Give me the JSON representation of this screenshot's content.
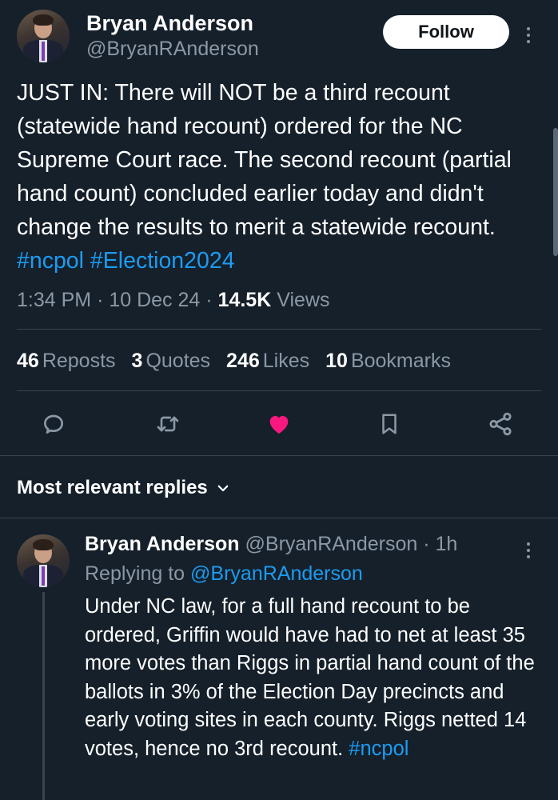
{
  "main_tweet": {
    "author_name": "Bryan Anderson",
    "author_handle": "@BryanRAnderson",
    "follow_label": "Follow",
    "text_parts": {
      "body": "JUST IN: There will NOT be a third recount (statewide hand recount) ordered for the NC Supreme Court race. The second recount (partial hand count) concluded earlier today and didn't change the results to merit a statewide recount. ",
      "hashtag1": "#ncpol",
      "hashtag2": "#Election2024"
    },
    "time": "1:34 PM",
    "date": "10 Dec 24",
    "views_count": "14.5K",
    "views_label": "Views"
  },
  "stats": {
    "reposts_count": "46",
    "reposts_label": "Reposts",
    "quotes_count": "3",
    "quotes_label": "Quotes",
    "likes_count": "246",
    "likes_label": "Likes",
    "bookmarks_count": "10",
    "bookmarks_label": "Bookmarks"
  },
  "actions": {
    "reply_icon": "reply-icon",
    "repost_icon": "repost-icon",
    "like_icon": "heart-icon",
    "bookmark_icon": "bookmark-icon",
    "share_icon": "share-icon",
    "like_color": "#f91880"
  },
  "replies_header": {
    "label": "Most relevant replies"
  },
  "reply": {
    "author_name": "Bryan Anderson",
    "author_handle": "@BryanRAnderson",
    "age": "1h",
    "replying_prefix": "Replying to",
    "replying_to": "@BryanRAnderson",
    "body": "Under NC law, for a full hand recount to be ordered, Griffin would have had to net at least 35 more votes than Riggs in partial hand count of the ballots in 3% of the Election Day precincts and early voting sites in each county. Riggs netted 14 votes, hence no 3rd recount. ",
    "hashtag": "#ncpol"
  },
  "colors": {
    "background": "#15202b",
    "accent": "#1d9bf0",
    "secondary_text": "#8b98a5",
    "divider": "#38444d"
  }
}
